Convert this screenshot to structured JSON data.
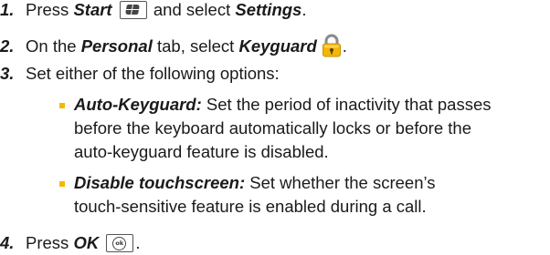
{
  "steps": [
    {
      "number": "1.",
      "t1": "Press ",
      "em1": "Start",
      "key_icon": "windows-start-key-icon",
      "t2": " and select ",
      "em2": "Settings",
      "t3": "."
    },
    {
      "number": "2.",
      "t1": "On the ",
      "em1": "Personal",
      "t2": " tab, select ",
      "em2": "Keyguard",
      "icon": "lock-icon",
      "t3": "."
    },
    {
      "number": "3.",
      "text": "Set either of the following options:"
    },
    {
      "number": "4.",
      "t1": "Press ",
      "em1": "OK",
      "key_icon": "ok-key-icon",
      "t2": "."
    }
  ],
  "options": [
    {
      "term": "Auto-Keyguard:",
      "lines": [
        " Set the period of inactivity that passes",
        "before the keyboard automatically locks or before the",
        "auto-keyguard feature is disabled."
      ]
    },
    {
      "term": "Disable touchscreen:",
      "lines": [
        " Set whether the screen’s",
        "touch-sensitive feature is enabled during a call."
      ]
    }
  ],
  "ok_key_glyph": "ok",
  "colors": {
    "text": "#1a1a1a",
    "bullet": "#f5b800",
    "lock_body": "#f2b705",
    "lock_shackle": "#8a8a8a"
  }
}
